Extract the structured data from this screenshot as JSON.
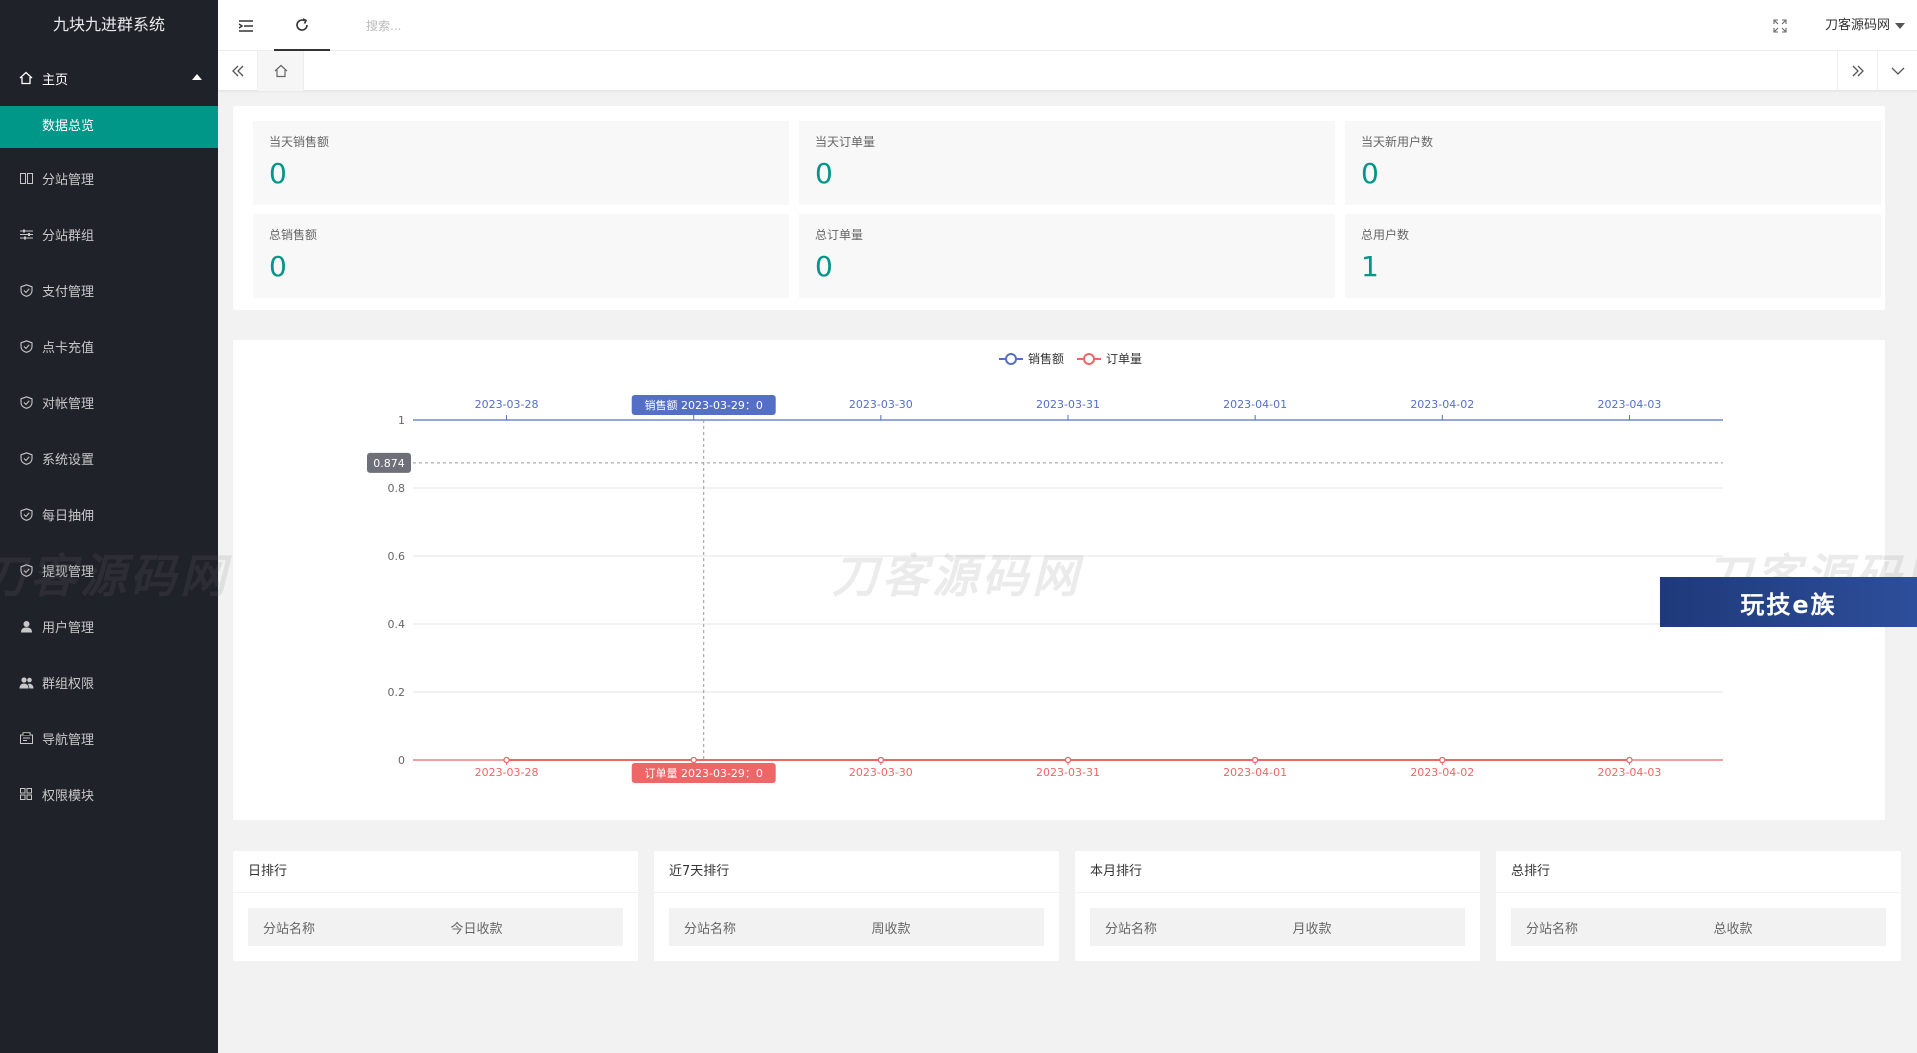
{
  "app": {
    "title": "九块九进群系统"
  },
  "sidebar": {
    "home": {
      "label": "主页",
      "icon": "home-icon"
    },
    "home_sub": {
      "label": "数据总览"
    },
    "items": [
      {
        "label": "分站管理",
        "icon": "columns-icon"
      },
      {
        "label": "分站群组",
        "icon": "sliders-icon"
      },
      {
        "label": "支付管理",
        "icon": "shield-icon"
      },
      {
        "label": "点卡充值",
        "icon": "shield-icon"
      },
      {
        "label": "对帐管理",
        "icon": "shield-icon"
      },
      {
        "label": "系统设置",
        "icon": "shield-icon"
      },
      {
        "label": "每日抽佣",
        "icon": "shield-icon"
      },
      {
        "label": "提现管理",
        "icon": "shield-icon"
      },
      {
        "label": "用户管理",
        "icon": "user-icon"
      },
      {
        "label": "群组权限",
        "icon": "users-icon"
      },
      {
        "label": "导航管理",
        "icon": "nav-icon"
      },
      {
        "label": "权限模块",
        "icon": "grid-icon"
      }
    ],
    "active_color": "#009688"
  },
  "header": {
    "search_placeholder": "搜索...",
    "user_name": "刀客源码网"
  },
  "stats": [
    {
      "label": "当天销售额",
      "value": "0"
    },
    {
      "label": "当天订单量",
      "value": "0"
    },
    {
      "label": "当天新用户数",
      "value": "0"
    },
    {
      "label": "总销售额",
      "value": "0"
    },
    {
      "label": "总订单量",
      "value": "0"
    },
    {
      "label": "总用户数",
      "value": "1"
    }
  ],
  "chart_data": {
    "type": "line",
    "categories": [
      "2023-03-28",
      "2023-03-29",
      "2023-03-30",
      "2023-03-31",
      "2023-04-01",
      "2023-04-02",
      "2023-04-03"
    ],
    "series": [
      {
        "name": "销售额",
        "values": [
          0,
          0,
          0,
          0,
          0,
          0,
          0
        ],
        "color": "#5470c6"
      },
      {
        "name": "订单量",
        "values": [
          0,
          0,
          0,
          0,
          0,
          0,
          0
        ],
        "color": "#ee6666"
      }
    ],
    "ylim": [
      0,
      1
    ],
    "yticks": [
      "0",
      "0.2",
      "0.4",
      "0.6",
      "0.8",
      "1"
    ],
    "legend": "top-center",
    "tooltip": {
      "top_text": "销售额  2023-03-29：0",
      "bottom_text": "订单量  2023-03-29：0",
      "y_pointer": "0.874",
      "pointer_value": 0.874
    }
  },
  "rankings": [
    {
      "title": "日排行",
      "col1": "分站名称",
      "col2": "今日收款"
    },
    {
      "title": "近7天排行",
      "col1": "分站名称",
      "col2": "周收款"
    },
    {
      "title": "本月排行",
      "col1": "分站名称",
      "col2": "月收款"
    },
    {
      "title": "总排行",
      "col1": "分站名称",
      "col2": "总收款"
    }
  ],
  "watermark": {
    "text": "刀客源码网",
    "badge": "玩技e族"
  }
}
